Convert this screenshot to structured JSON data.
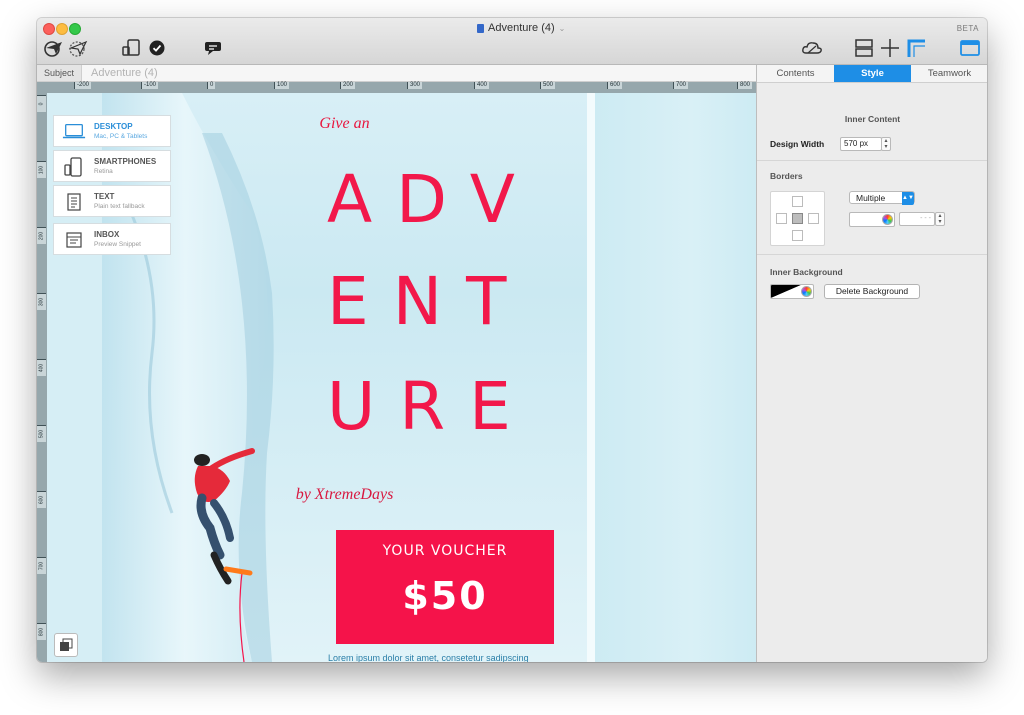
{
  "window": {
    "title": "Adventure (4)",
    "beta_label": "BETA"
  },
  "toolbar": {
    "icons": [
      "send-icon",
      "preview-icon",
      "device-icon",
      "check-icon",
      "chat-icon",
      "cloud-icon",
      "layout-icon",
      "move-icon",
      "corner-icon",
      "panel-icon"
    ]
  },
  "subject": {
    "label": "Subject",
    "value": "Adventure (4)"
  },
  "ruler": {
    "h_ticks": [
      "-200",
      "-100",
      "0",
      "100",
      "200",
      "300",
      "400",
      "500",
      "600",
      "700",
      "800"
    ],
    "v_ticks": [
      "0",
      "100",
      "200",
      "300",
      "400",
      "500",
      "600",
      "700",
      "800"
    ]
  },
  "devices": [
    {
      "name": "DESKTOP",
      "sub": "Mac, PC & Tablets",
      "active": true
    },
    {
      "name": "SMARTPHONES",
      "sub": "Retina",
      "active": false
    },
    {
      "name": "TEXT",
      "sub": "Plain text fallback",
      "active": false
    },
    {
      "name": "INBOX",
      "sub": "Preview Snippet",
      "active": false
    }
  ],
  "email": {
    "give": "Give an",
    "line1": "ADV",
    "line2": "ENT",
    "line3": "URE",
    "by": "by XtremeDays",
    "voucher_title": "YOUR VOUCHER",
    "voucher_amount": "$50",
    "lorem": "Lorem ipsum dolor sit amet, consetetur sadipscing"
  },
  "panel": {
    "tabs": [
      "Contents",
      "Style",
      "Teamwork"
    ],
    "active_tab": "Style",
    "inner_content_title": "Inner Content",
    "design_width_label": "Design Width",
    "design_width_value": "570 px",
    "borders_title": "Borders",
    "borders_mode": "Multiple",
    "border_size_placeholder": "- - -",
    "inner_background_title": "Inner Background",
    "delete_background_label": "Delete Background"
  },
  "colors": {
    "accent": "#1e8ee6",
    "brand_red": "#f5134a",
    "canvas_bg": "#d6eef5"
  }
}
